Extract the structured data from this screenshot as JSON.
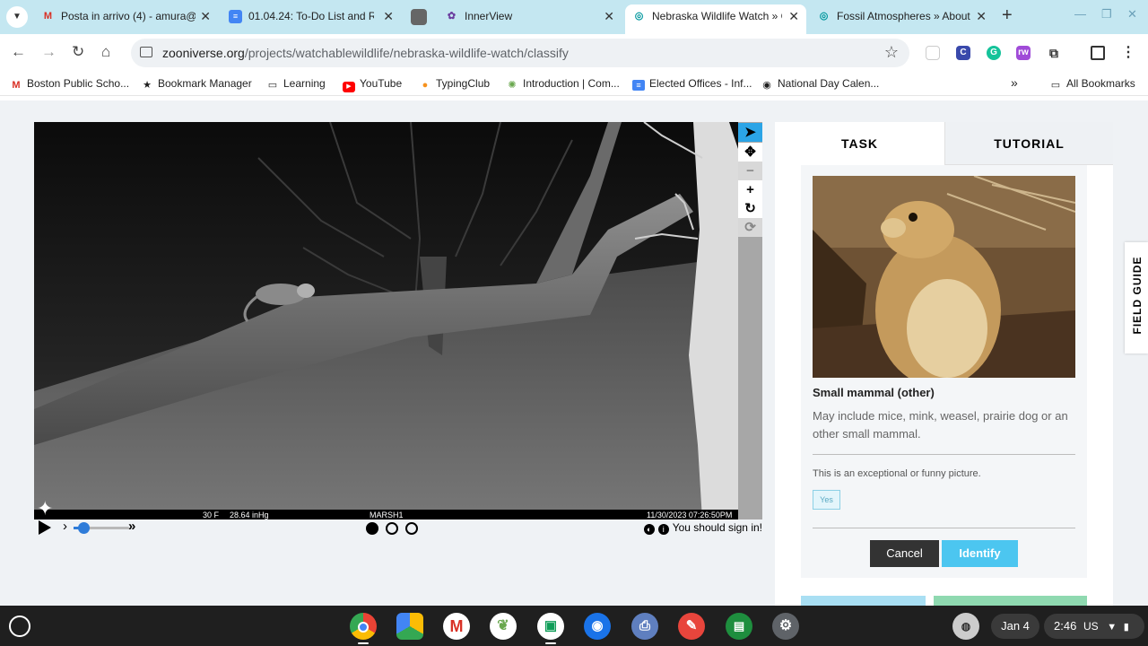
{
  "browser": {
    "tabs": [
      {
        "title": "Posta in arrivo (4) - amura@",
        "icon": "gmail-icon",
        "active": false
      },
      {
        "title": "01.04.24: To-Do List and Re",
        "icon": "docs-icon",
        "active": false
      },
      {
        "title": "",
        "icon": "blank-tab-icon",
        "active": false
      },
      {
        "title": "InnerView",
        "icon": "innerview-icon",
        "active": false
      },
      {
        "title": "Nebraska Wildlife Watch » C",
        "icon": "zooniverse-icon",
        "active": true
      },
      {
        "title": "Fossil Atmospheres » About",
        "icon": "zooniverse-icon",
        "active": false
      }
    ],
    "url_host": "zooniverse.org",
    "url_path": "/projects/watchablewildlife/nebraska-wildlife-watch/classify",
    "bookmarks": [
      {
        "label": "Boston Public Scho...",
        "icon": "gmail-icon"
      },
      {
        "label": "Bookmark Manager",
        "icon": "star-icon"
      },
      {
        "label": "Learning",
        "icon": "folder-icon"
      },
      {
        "label": "YouTube",
        "icon": "youtube-icon"
      },
      {
        "label": "TypingClub",
        "icon": "typingclub-icon"
      },
      {
        "label": "Introduction | Com...",
        "icon": "introduction-icon"
      },
      {
        "label": "Elected Offices - Inf...",
        "icon": "docs-icon"
      },
      {
        "label": "National Day Calen...",
        "icon": "globe-icon"
      }
    ],
    "all_bookmarks": "All Bookmarks"
  },
  "viewer": {
    "overlay_temp": "30 F",
    "overlay_pressure": "28.64 inHg",
    "overlay_camera": "MARSH1",
    "overlay_datetime": "11/30/2023  07:26:50PM",
    "frame_count": 3,
    "active_frame": 1,
    "signin_text": "You should sign in!"
  },
  "panel": {
    "tab_task": "TASK",
    "tab_tutorial": "TUTORIAL",
    "choice_title": "Small mammal (other)",
    "choice_desc": "May include mice, mink, weasel, prairie dog or an other small mammal.",
    "question": "This is an exceptional or funny picture.",
    "yes_label": "Yes",
    "cancel_label": "Cancel",
    "identify_label": "Identify",
    "field_guide": "FIELD GUIDE"
  },
  "shelf": {
    "date": "Jan 4",
    "time": "2:46",
    "locale": "US"
  }
}
